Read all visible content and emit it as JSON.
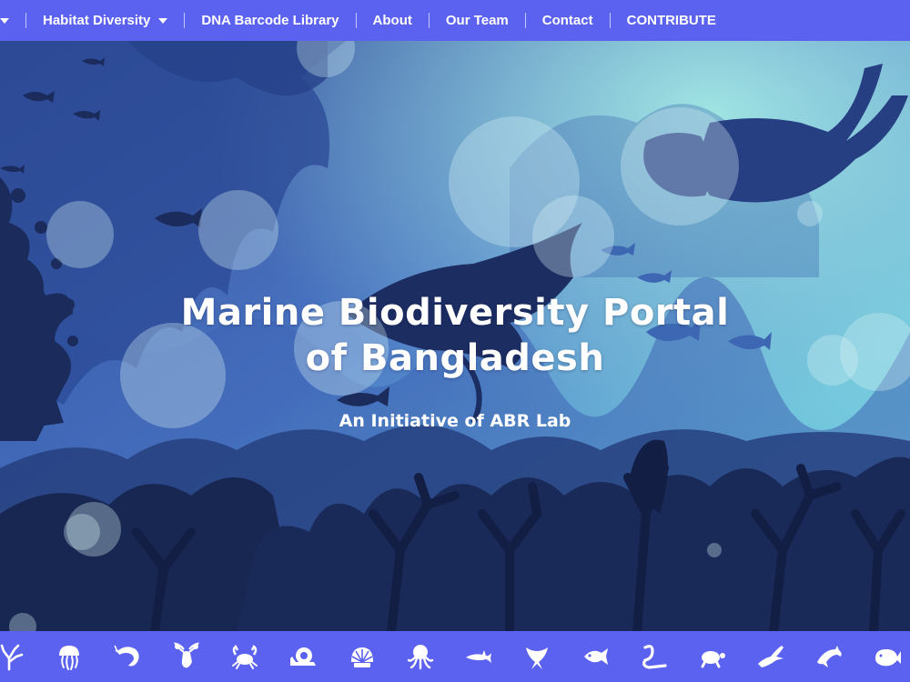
{
  "nav": {
    "items": [
      {
        "label": "Habitat Diversity",
        "has_dropdown": true
      },
      {
        "label": "DNA Barcode Library"
      },
      {
        "label": "About"
      },
      {
        "label": "Our Team"
      },
      {
        "label": "Contact"
      },
      {
        "label": "CONTRIBUTE"
      }
    ],
    "background": "#5b62f0"
  },
  "hero": {
    "title_line1": "Marine Biodiversity Portal",
    "title_line2": "of Bangladesh",
    "subtitle": "An Initiative of ABR Lab"
  },
  "category_icons": [
    "coral-icon",
    "jellyfish-icon",
    "shrimp-icon",
    "lobster-icon",
    "crab-icon",
    "snail-icon",
    "shell-icon",
    "octopus-icon",
    "shark-icon",
    "ray-icon",
    "fish-icon",
    "eel-icon",
    "turtle-icon",
    "crocodile-icon",
    "dolphin-icon",
    "whale-icon"
  ]
}
